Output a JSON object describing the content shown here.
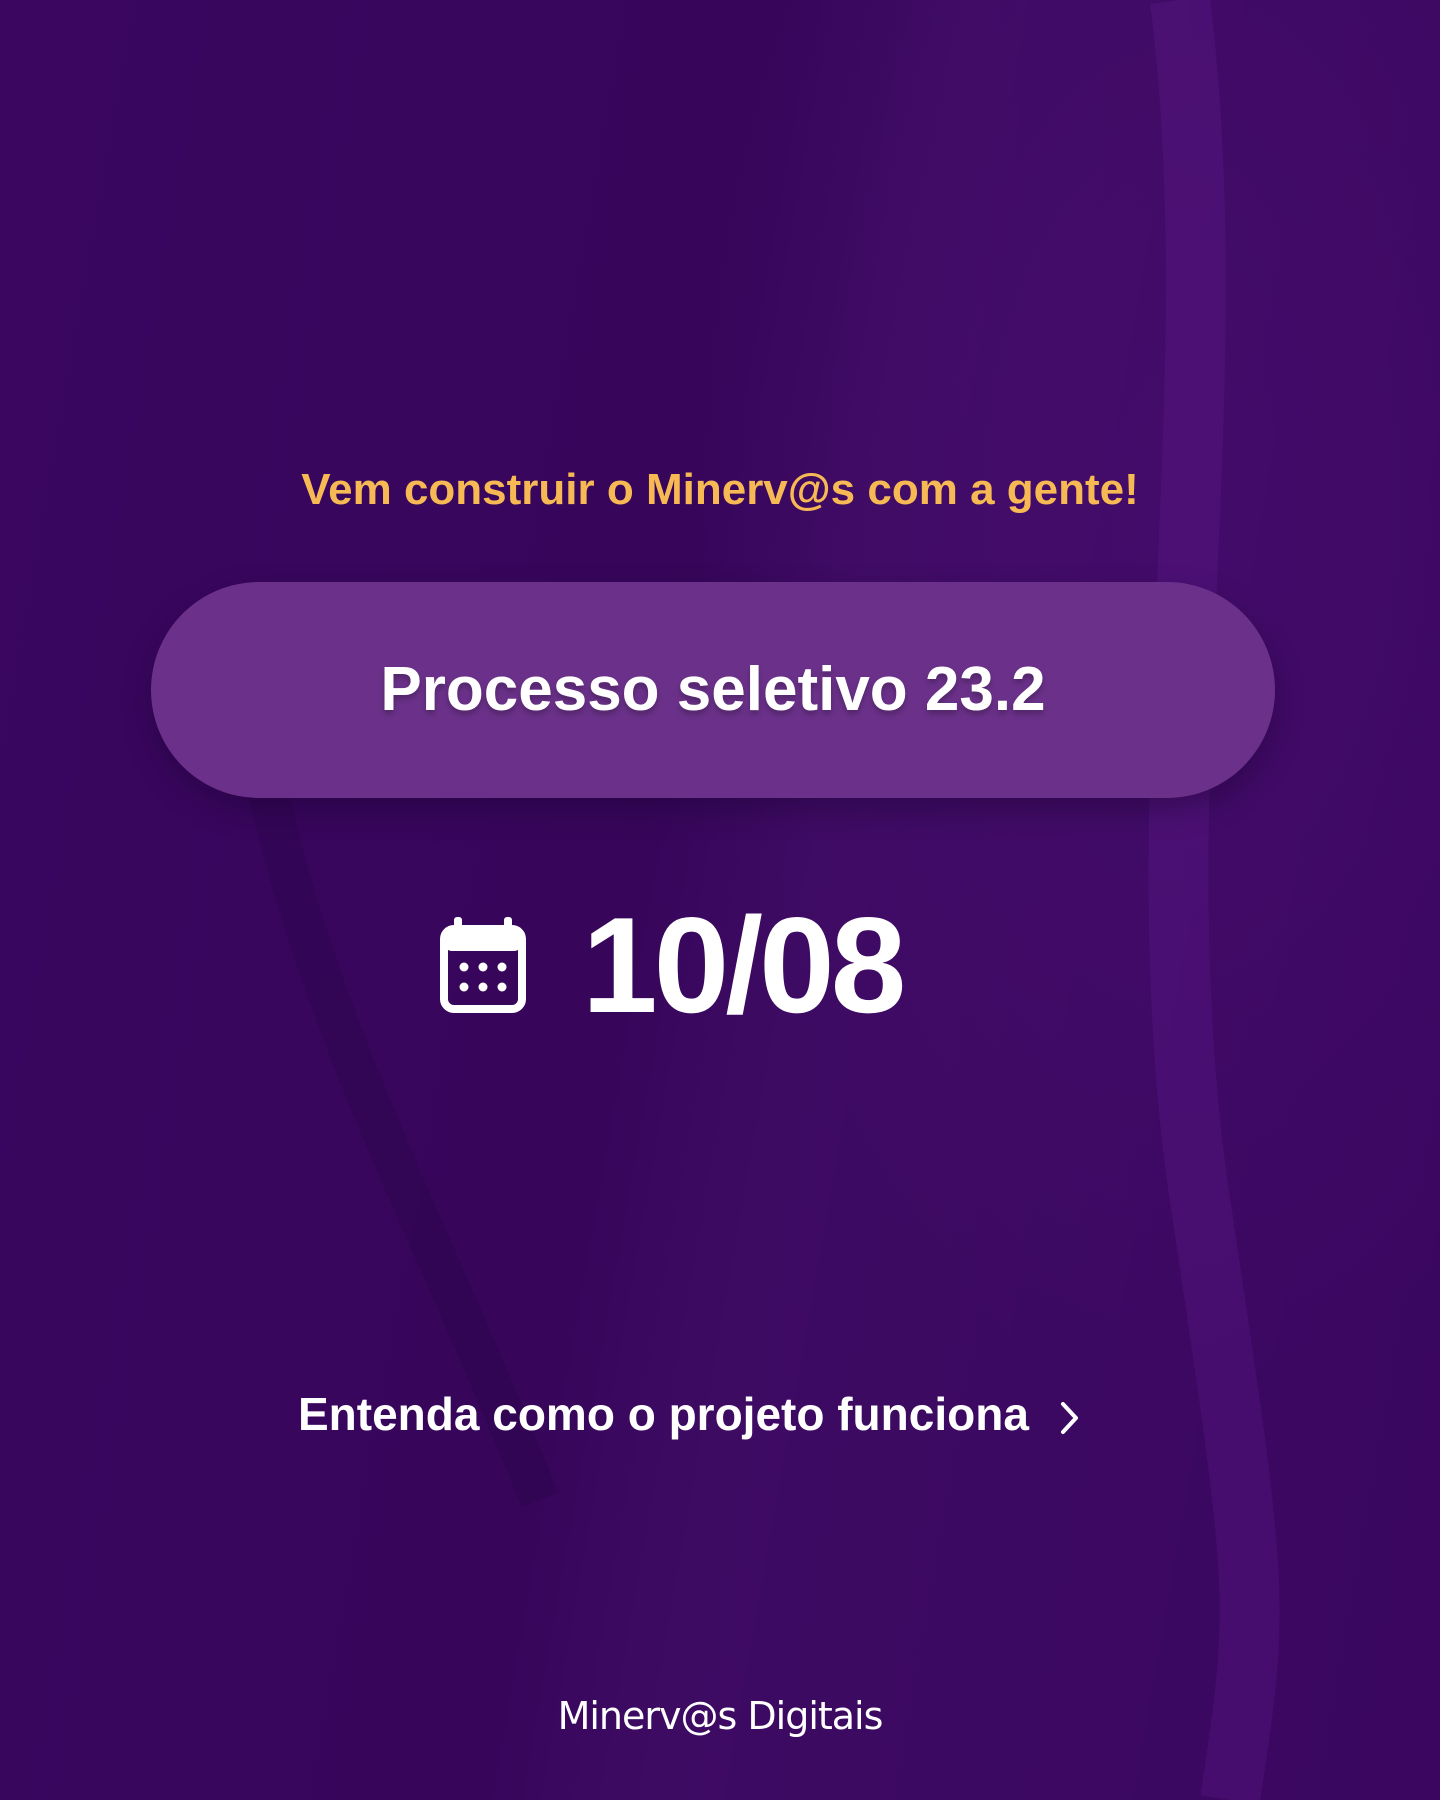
{
  "colors": {
    "background": "#3a0660",
    "accent": "#f7b954",
    "pill": "#6b318a",
    "text": "#ffffff"
  },
  "headline": "Vem construir o Minerv@s com a gente!",
  "selection_process": {
    "label": "Processo seletivo 23.2"
  },
  "date": {
    "icon": "calendar-icon",
    "value": "10/08"
  },
  "cta": {
    "label": "Entenda como o projeto funciona",
    "icon": "chevron-right-icon"
  },
  "brand": "Minerv@s Digitais"
}
